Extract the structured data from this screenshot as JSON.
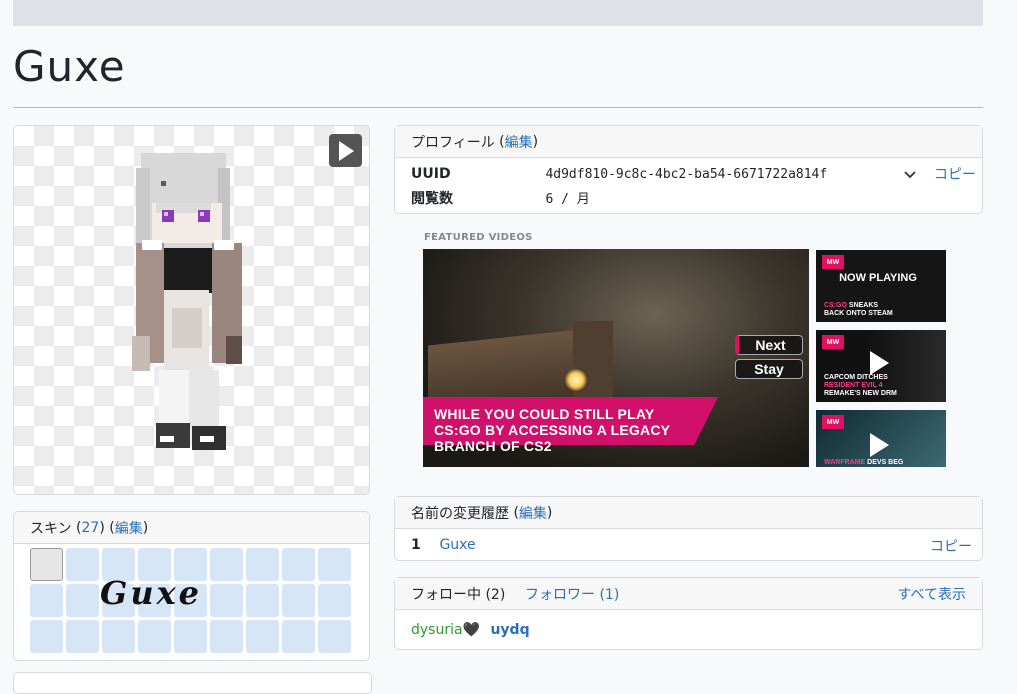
{
  "page": {
    "title": "Guxe"
  },
  "profile": {
    "header": "プロフィール",
    "edit_label": "編集",
    "uuid_label": "UUID",
    "uuid_value": "4d9df810-9c8c-4bc2-ba54-6671722a814f",
    "copy_label": "コピー",
    "views_label": "閲覧数",
    "views_value": "6 / 月"
  },
  "video": {
    "section_label": "FEATURED VIDEOS",
    "caption": "WHILE YOU COULD STILL PLAY CS:GO BY ACCESSING A LEGACY BRANCH OF CS2",
    "next_label": "Next",
    "stay_label": "Stay",
    "thumbnails": [
      {
        "status": "NOW PLAYING",
        "title_pink": "CS:GO",
        "title_white": "SNEAKS",
        "subtitle": "BACK ONTO STEAM"
      },
      {
        "title_white": "CAPCOM DITCHES",
        "title_pink": "RESIDENT EVIL 4",
        "subtitle": "REMAKE'S NEW DRM"
      },
      {
        "title_pink": "WARFRAME",
        "title_white": "DEVS BEG"
      }
    ],
    "logo": "MW"
  },
  "names": {
    "header": "名前の変更履歴",
    "edit_label": "編集",
    "rows": [
      {
        "index": "1",
        "name": "Guxe",
        "copy_label": "コピー"
      }
    ]
  },
  "follow": {
    "following_label": "フォロー中 (2)",
    "followers_label": "フォロワー (1)",
    "show_all": "すべて表示",
    "users": [
      {
        "name": "dysuria",
        "suffix": "🖤"
      },
      {
        "name": "uydq"
      }
    ]
  },
  "skins": {
    "header": "スキン",
    "count": "27",
    "edit_label": "編集",
    "art_text": "Guxe"
  }
}
